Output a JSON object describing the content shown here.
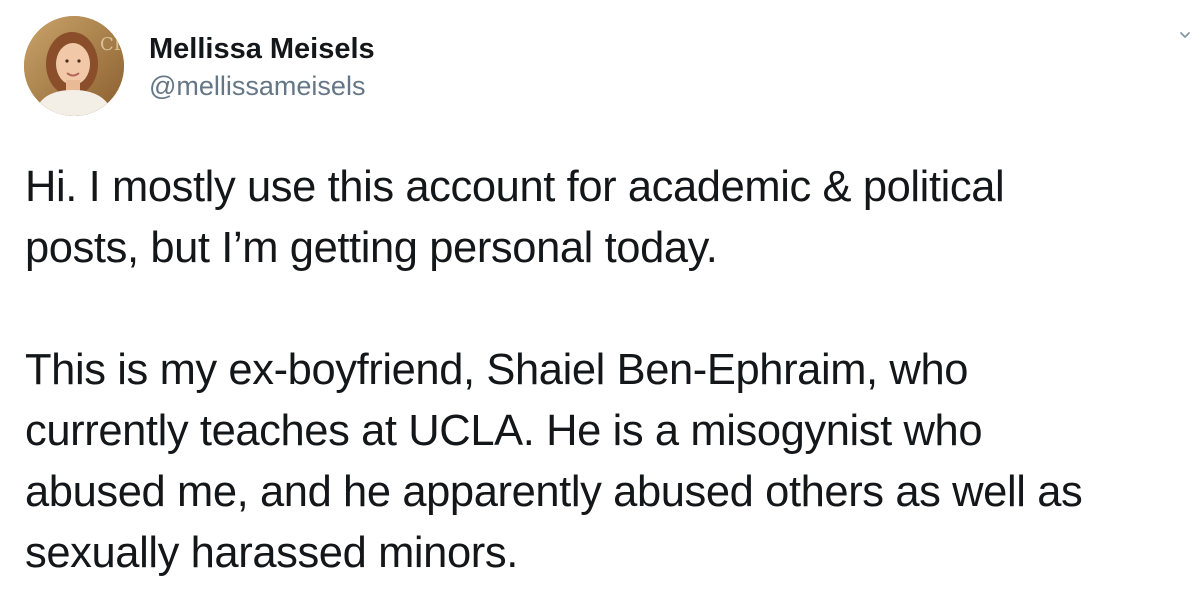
{
  "tweet": {
    "author": {
      "display_name": "Mellissa Meisels",
      "handle": "@mellissameisels",
      "avatar_icon": "profile-photo"
    },
    "menu_icon": "chevron-down-icon",
    "paragraphs": [
      "Hi. I mostly use this account for academic & political\nposts, but I’m getting personal today.",
      "This is my ex-boyfriend, Shaiel Ben-Ephraim, who\ncurrently teaches at UCLA. He is a misogynist who\nabused me, and he apparently abused others as well as\nsexually harassed minors."
    ]
  }
}
